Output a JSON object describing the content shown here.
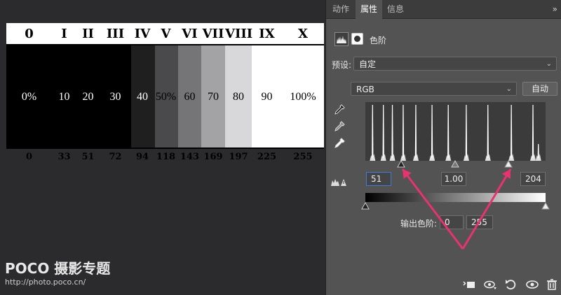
{
  "zone_chart": {
    "roman": [
      "0",
      "I",
      "II",
      "III",
      "IV",
      "V",
      "VI",
      "VII",
      "VIII",
      "IX",
      "X"
    ],
    "percent": [
      "0%",
      "10",
      "20",
      "30",
      "40",
      "50%",
      "60",
      "70",
      "80",
      "90",
      "100%"
    ],
    "values": [
      "0",
      "33",
      "51",
      "72",
      "94",
      "118",
      "143",
      "169",
      "197",
      "225",
      "255"
    ],
    "colors": [
      "#000000",
      "#000000",
      "#000000",
      "#000000",
      "#1f1f20",
      "#4a494b",
      "#757476",
      "#a3a2a4",
      "#d8d7d9",
      "#ffffff",
      "#ffffff"
    ],
    "text_colors": [
      "#ffffff",
      "#ffffff",
      "#ffffff",
      "#ffffff",
      "#ffffff",
      "#000000",
      "#000000",
      "#000000",
      "#000000",
      "#000000",
      "#000000"
    ]
  },
  "watermark": {
    "brand": "POCO 摄影专题",
    "url": "http://photo.poco.cn/"
  },
  "panel": {
    "tabs": [
      {
        "label": "动作",
        "active": false
      },
      {
        "label": "属性",
        "active": true
      },
      {
        "label": "信息",
        "active": false
      }
    ],
    "collapse_icon": "»",
    "adjustment_title": "色阶",
    "preset_label": "预设:",
    "preset_value": "自定",
    "channel_value": "RGB",
    "auto_label": "自动",
    "input_black": "51",
    "input_gamma": "1.00",
    "input_white": "204",
    "output_label": "输出色阶:",
    "output_black": "0",
    "output_white": "255",
    "histogram_peaks": [
      0.04,
      0.1,
      0.15,
      0.21,
      0.28,
      0.37,
      0.46,
      0.56,
      0.68,
      0.81,
      0.93,
      0.96
    ],
    "arrow_color": "#e8336e"
  }
}
